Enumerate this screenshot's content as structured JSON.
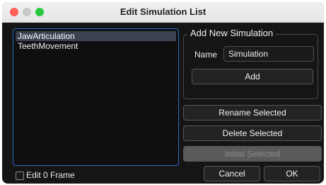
{
  "window": {
    "title": "Edit Simulation List"
  },
  "simulation_list": {
    "items": [
      {
        "label": "JawArticulation",
        "selected": true
      },
      {
        "label": "TeethMovement",
        "selected": false
      }
    ]
  },
  "add_group": {
    "title": "Add New Simulation",
    "name_label": "Name",
    "name_value": "Simulation",
    "add_label": "Add"
  },
  "actions": {
    "rename_label": "Rename Selected",
    "delete_label": "Delete Selected",
    "initial_label": "Initial Selected"
  },
  "footer": {
    "edit_frame_label": "Edit 0 Frame",
    "edit_frame_checked": false,
    "cancel_label": "Cancel",
    "ok_label": "OK"
  },
  "colors": {
    "accent": "#2d6ac4",
    "close": "#ff5f57",
    "maximize": "#28c840"
  }
}
